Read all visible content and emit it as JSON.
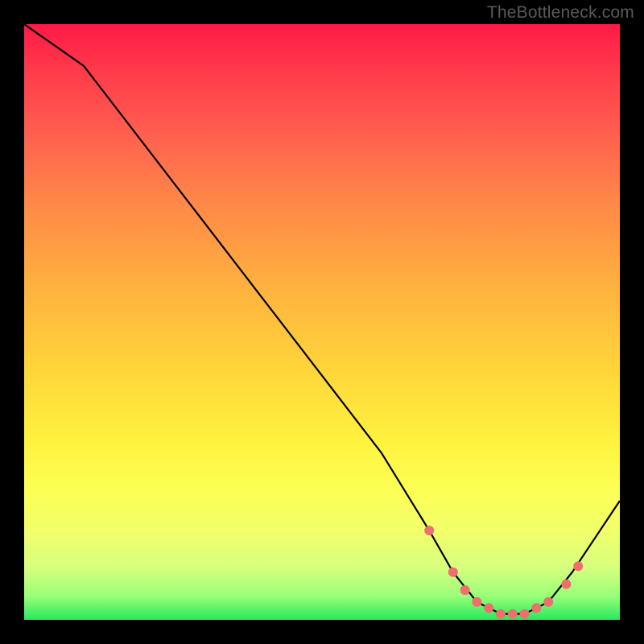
{
  "watermark": "TheBottleneck.com",
  "chart_data": {
    "type": "line",
    "title": "",
    "xlabel": "",
    "ylabel": "",
    "xlim": [
      0,
      100
    ],
    "ylim": [
      0,
      100
    ],
    "series": [
      {
        "name": "curve",
        "x": [
          0,
          10,
          20,
          30,
          40,
          50,
          60,
          68,
          72,
          76,
          80,
          84,
          88,
          92,
          100
        ],
        "y": [
          100,
          93,
          80,
          67,
          54,
          41,
          28,
          15,
          8,
          3,
          1,
          1,
          3,
          8,
          20
        ],
        "color": "#000000"
      }
    ],
    "markers": {
      "name": "highlight-dots",
      "color": "#ef6e6e",
      "x": [
        68,
        72,
        74,
        76,
        78,
        80,
        82,
        84,
        86,
        88,
        91,
        93
      ],
      "y": [
        15,
        8,
        5,
        3,
        2,
        1,
        1,
        1,
        2,
        3,
        6,
        9
      ]
    },
    "gradient_stops": [
      {
        "pos": 0.0,
        "color": "#ff1a46"
      },
      {
        "pos": 0.3,
        "color": "#ff8848"
      },
      {
        "pos": 0.6,
        "color": "#ffe03b"
      },
      {
        "pos": 0.85,
        "color": "#f4ff61"
      },
      {
        "pos": 1.0,
        "color": "#26e95f"
      }
    ]
  }
}
